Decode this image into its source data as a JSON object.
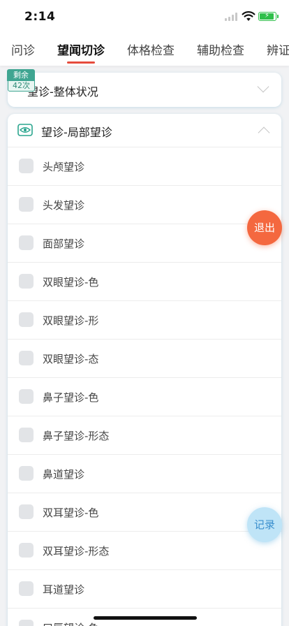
{
  "status": {
    "time": "2:14"
  },
  "tabs": [
    {
      "label": "问诊"
    },
    {
      "label": "望闻切诊"
    },
    {
      "label": "体格检查"
    },
    {
      "label": "辅助检查"
    },
    {
      "label": "辨证"
    }
  ],
  "active_tab": "望闻切诊",
  "badge": {
    "top": "剩余",
    "bottom": "42次"
  },
  "sections": {
    "overall": {
      "title": "望诊-整体状况"
    },
    "local": {
      "title": "望诊-局部望诊",
      "items": [
        {
          "label": "头颅望诊"
        },
        {
          "label": "头发望诊"
        },
        {
          "label": "面部望诊"
        },
        {
          "label": "双眼望诊-色"
        },
        {
          "label": "双眼望诊-形"
        },
        {
          "label": "双眼望诊-态"
        },
        {
          "label": "鼻子望诊-色"
        },
        {
          "label": "鼻子望诊-形态"
        },
        {
          "label": "鼻道望诊"
        },
        {
          "label": "双耳望诊-色"
        },
        {
          "label": "双耳望诊-形态"
        },
        {
          "label": "耳道望诊"
        },
        {
          "label": "口唇望诊-色"
        }
      ]
    }
  },
  "buttons": {
    "exit": "退出",
    "record": "记录"
  },
  "colors": {
    "accent_red": "#e64b3c",
    "exit": "#f4683f",
    "badge": "#3fa591",
    "record": "#bfe4f7"
  }
}
